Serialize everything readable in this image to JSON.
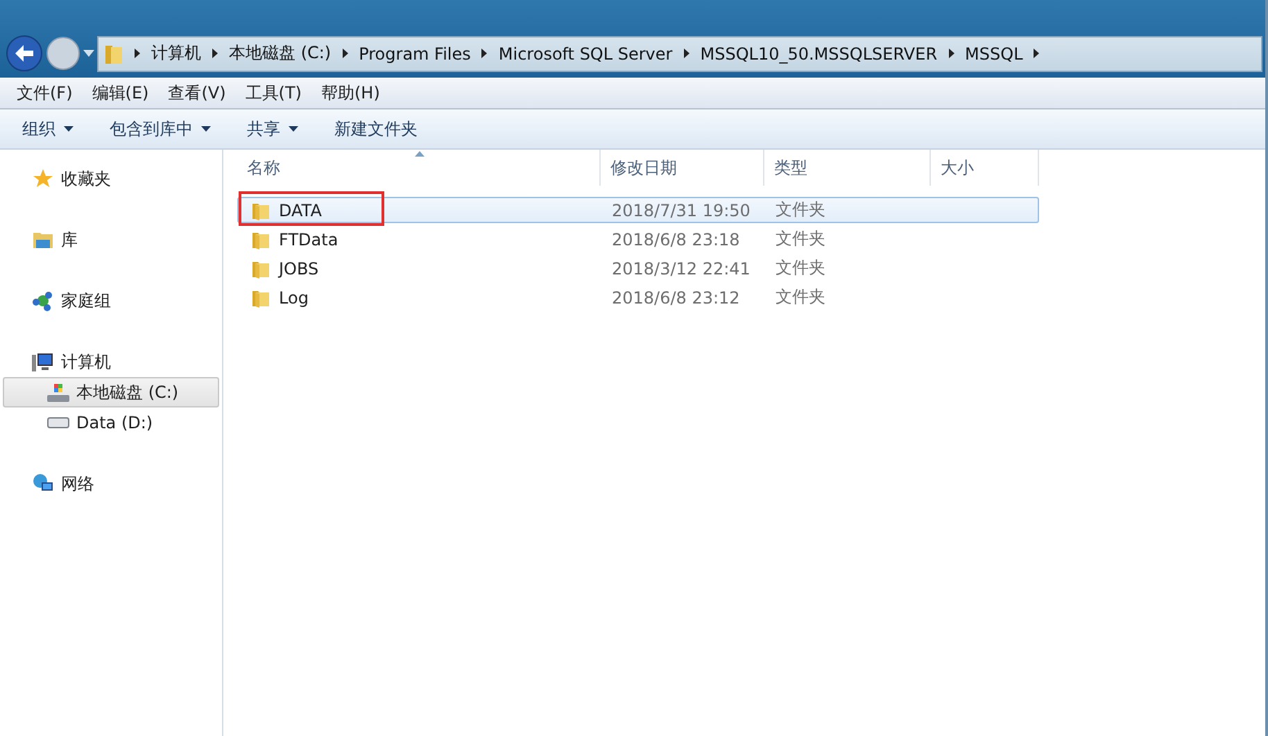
{
  "address_bar": {
    "crumbs": [
      "计算机",
      "本地磁盘 (C:)",
      "Program Files",
      "Microsoft SQL Server",
      "MSSQL10_50.MSSQLSERVER",
      "MSSQL"
    ]
  },
  "menu_bar": [
    "文件(F)",
    "编辑(E)",
    "查看(V)",
    "工具(T)",
    "帮助(H)"
  ],
  "toolbar": [
    {
      "label": "组织",
      "dropdown": true
    },
    {
      "label": "包含到库中",
      "dropdown": true
    },
    {
      "label": "共享",
      "dropdown": true
    },
    {
      "label": "新建文件夹",
      "dropdown": false
    }
  ],
  "sidebar": {
    "groups": [
      {
        "label": "收藏夹",
        "kind": "star"
      },
      {
        "label": "库",
        "kind": "library"
      },
      {
        "label": "家庭组",
        "kind": "homegroup"
      },
      {
        "label": "计算机",
        "kind": "computer",
        "items": [
          {
            "label": "本地磁盘 (C:)",
            "kind": "system-drive",
            "selected": true
          },
          {
            "label": "Data (D:)",
            "kind": "drive",
            "selected": false
          }
        ]
      },
      {
        "label": "网络",
        "kind": "network"
      }
    ]
  },
  "table": {
    "columns": [
      "名称",
      "修改日期",
      "类型",
      "大小"
    ],
    "rows": [
      {
        "name": "DATA",
        "modified": "2018/7/31 19:50",
        "type": "文件夹",
        "selected": true,
        "annotated": true
      },
      {
        "name": "FTData",
        "modified": "2018/6/8 23:18",
        "type": "文件夹",
        "selected": false,
        "annotated": false
      },
      {
        "name": "JOBS",
        "modified": "2018/3/12 22:41",
        "type": "文件夹",
        "selected": false,
        "annotated": false
      },
      {
        "name": "Log",
        "modified": "2018/6/8 23:12",
        "type": "文件夹",
        "selected": false,
        "annotated": false
      }
    ]
  }
}
